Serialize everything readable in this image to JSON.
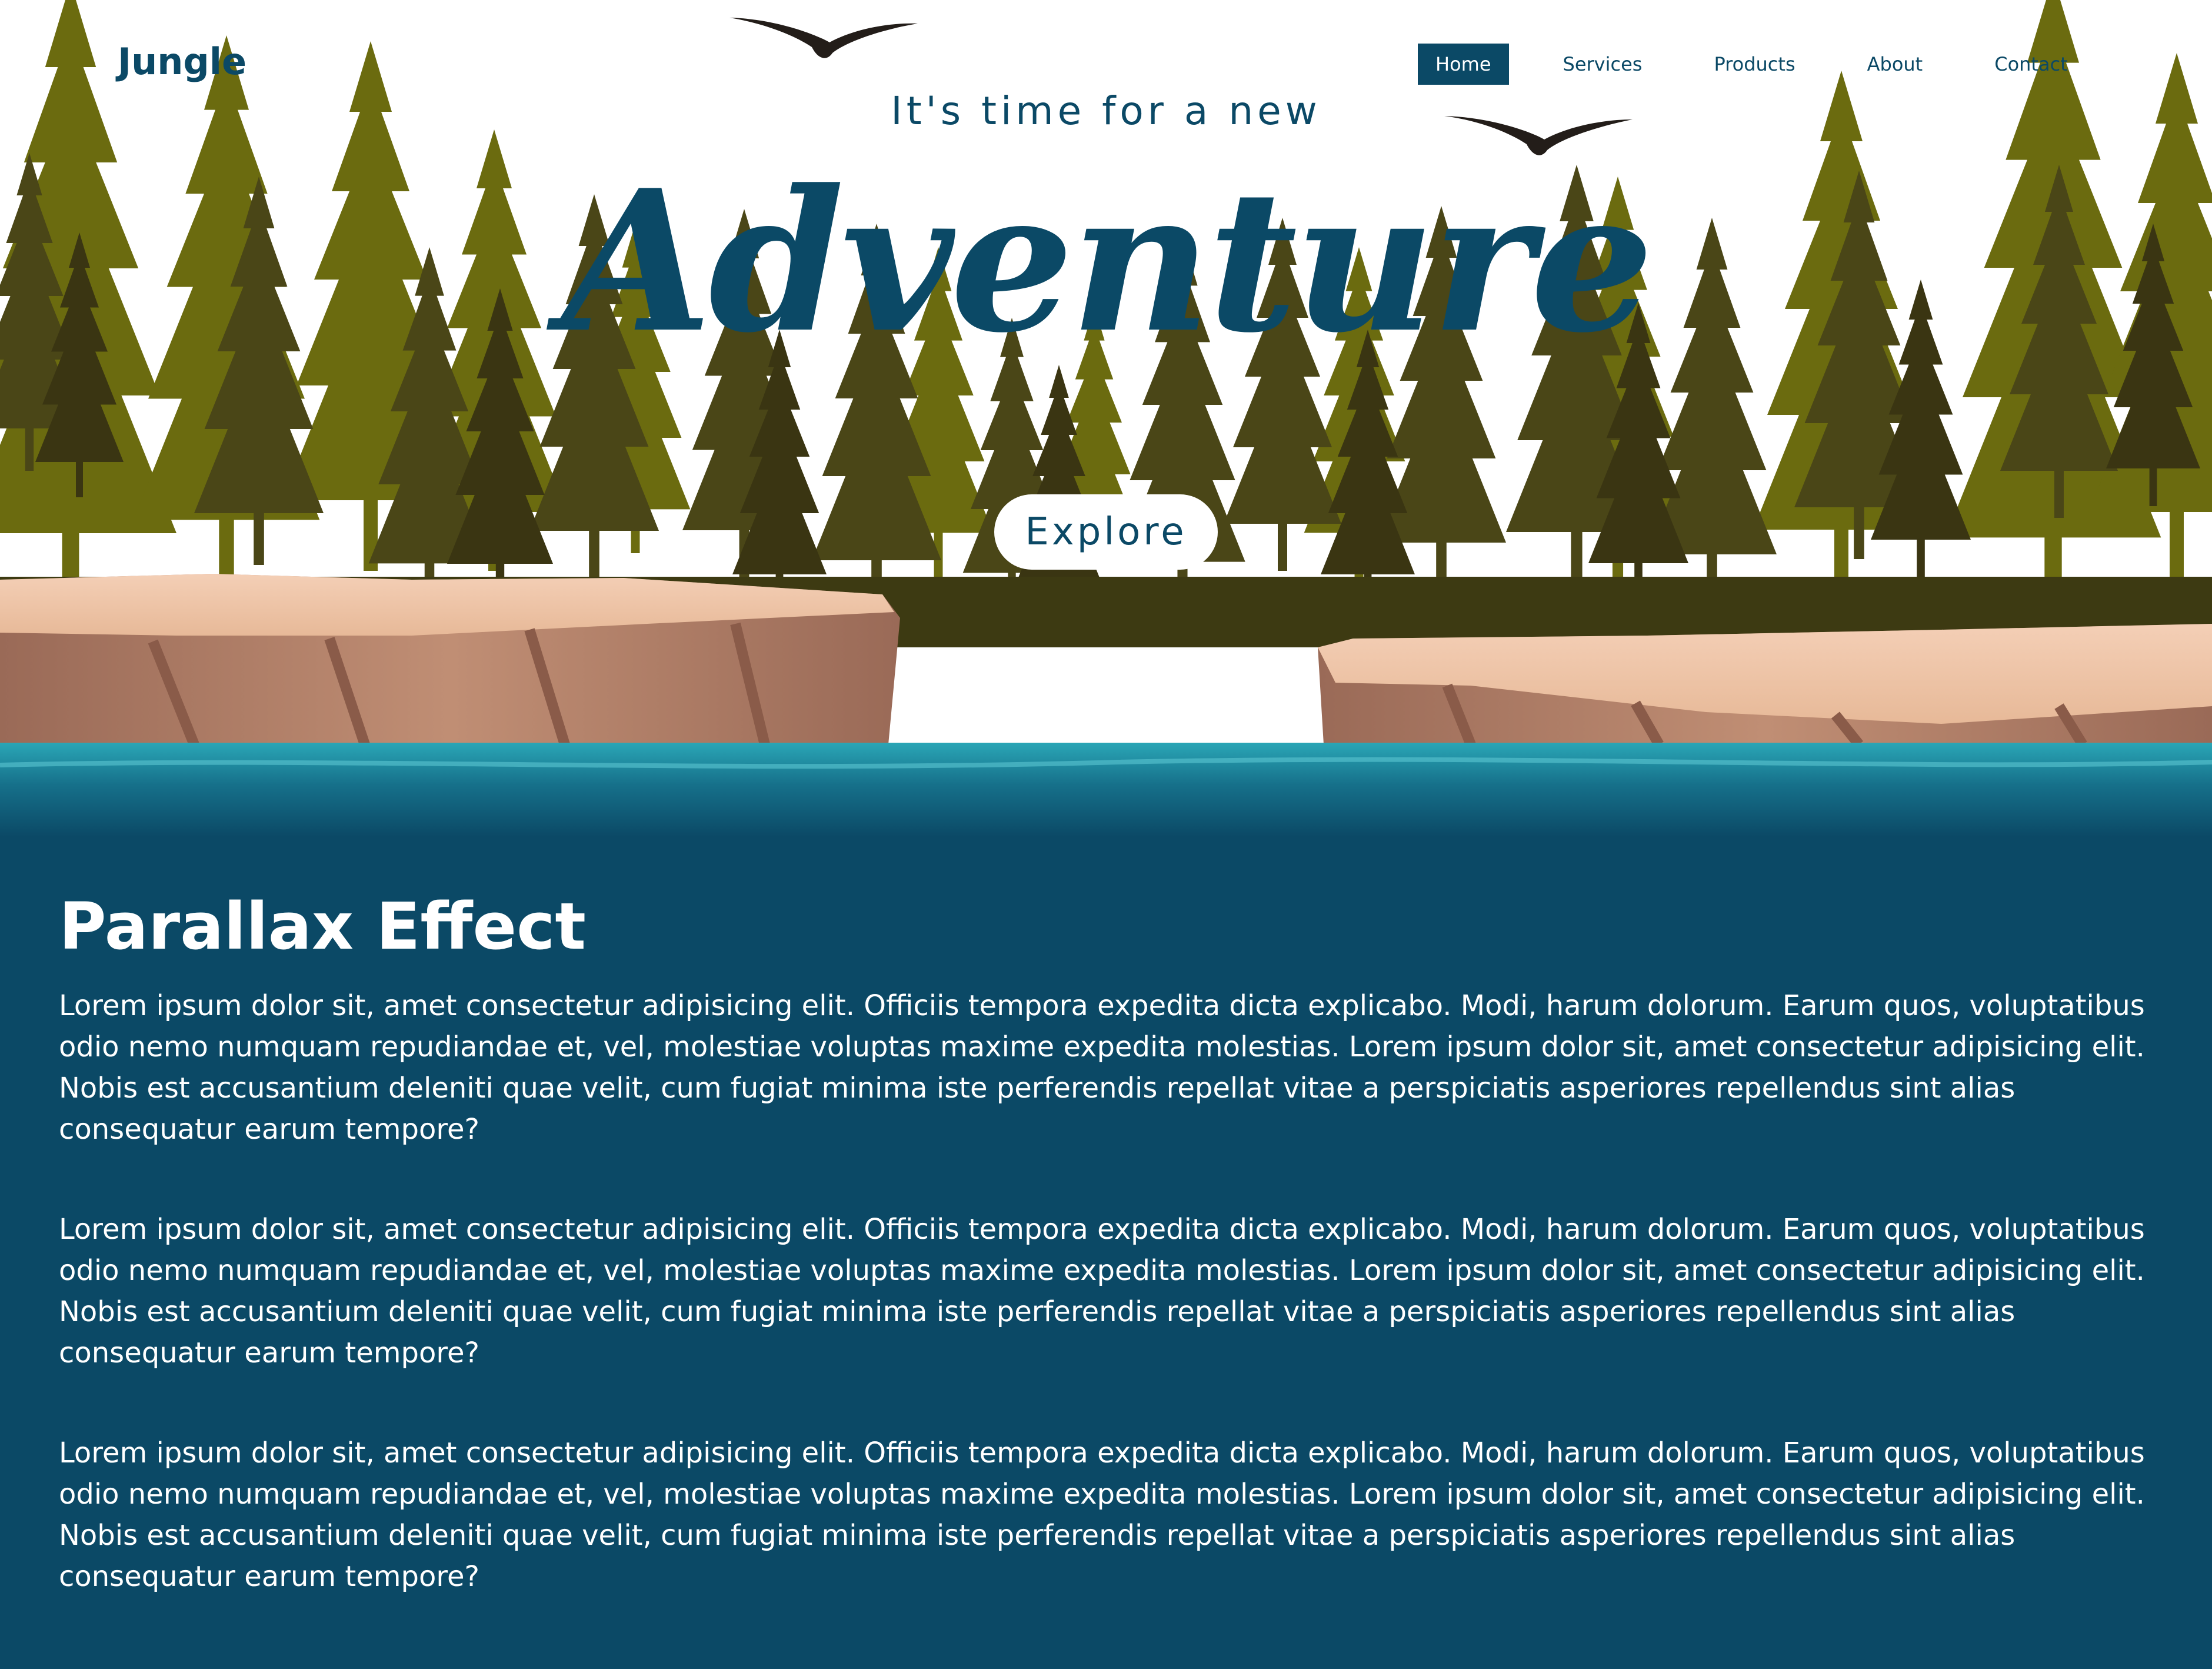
{
  "header": {
    "logo": "Jungle",
    "nav": [
      {
        "label": "Home",
        "active": true
      },
      {
        "label": "Services",
        "active": false
      },
      {
        "label": "Products",
        "active": false
      },
      {
        "label": "About",
        "active": false
      },
      {
        "label": "Contact",
        "active": false
      }
    ]
  },
  "hero": {
    "subtitle": "It's time for a new",
    "title": "Adventure",
    "button_label": "Explore"
  },
  "content": {
    "heading": "Parallax Effect",
    "paragraphs": [
      "Lorem ipsum dolor sit, amet consectetur adipisicing elit. Officiis tempora expedita dicta explicabo. Modi, harum dolorum. Earum quos, voluptatibus odio nemo numquam repudiandae et, vel, molestiae voluptas maxime expedita molestias. Lorem ipsum dolor sit, amet consectetur adipisicing elit. Nobis est accusantium deleniti quae velit, cum fugiat minima iste perferendis repellat vitae a perspiciatis asperiores repellendus sint alias consequatur earum tempore?",
      "Lorem ipsum dolor sit, amet consectetur adipisicing elit. Officiis tempora expedita dicta explicabo. Modi, harum dolorum. Earum quos, voluptatibus odio nemo numquam repudiandae et, vel, molestiae voluptas maxime expedita molestias. Lorem ipsum dolor sit, amet consectetur adipisicing elit. Nobis est accusantium deleniti quae velit, cum fugiat minima iste perferendis repellat vitae a perspiciatis asperiores repellendus sint alias consequatur earum tempore?",
      "Lorem ipsum dolor sit, amet consectetur adipisicing elit. Officiis tempora expedita dicta explicabo. Modi, harum dolorum. Earum quos, voluptatibus odio nemo numquam repudiandae et, vel, molestiae voluptas maxime expedita molestias. Lorem ipsum dolor sit, amet consectetur adipisicing elit. Nobis est accusantium deleniti quae velit, cum fugiat minima iste perferendis repellat vitae a perspiciatis asperiores repellendus sint alias consequatur earum tempore?"
    ]
  },
  "colors": {
    "brand": "#0b4966",
    "forest_light": "#6b6b0f",
    "forest_dark": "#3d3a12",
    "water": "#1f8fa3",
    "cliff": "#c99a7c"
  },
  "icons": [
    "bird-icon",
    "bird-icon"
  ]
}
